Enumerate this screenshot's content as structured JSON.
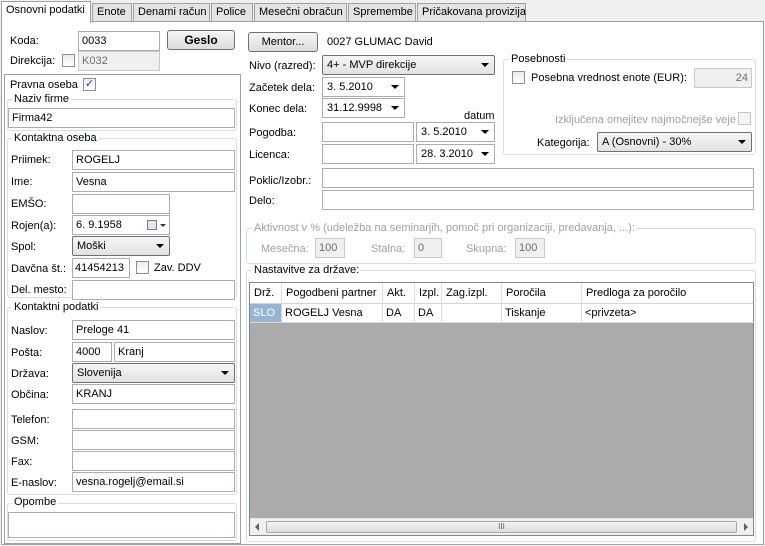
{
  "tabs": [
    "Osnovni podatki",
    "Enote",
    "Denami račun",
    "Police",
    "Mesečni obračun",
    "Spremembe",
    "Pričakovana provizija"
  ],
  "header": {
    "koda_label": "Koda:",
    "koda_value": "0033",
    "geslo_button": "Geslo",
    "direkcija_label": "Direkcija:",
    "direkcija_value": "K032",
    "mentor_button": "Mentor...",
    "mentor_value": "0027 GLUMAC David"
  },
  "left": {
    "pravna_oseba_label": "Pravna oseba",
    "pravna_oseba_checked": "✓",
    "naziv_firme_title": "Naziv firme",
    "naziv_firme_value": "Firma42",
    "kontaktna_oseba_title": "Kontaktna oseba",
    "priimek_label": "Priimek:",
    "priimek_value": "ROGELJ",
    "ime_label": "Ime:",
    "ime_value": "Vesna",
    "emso_label": "EMŠO:",
    "emso_value": "",
    "rojen_label": "Rojen(a):",
    "rojen_value": "6. 9.1958",
    "spol_label": "Spol:",
    "spol_value": "Moški",
    "davcna_label": "Davčna št.:",
    "davcna_value": "41454213",
    "zav_ddv_label": "Zav. DDV",
    "del_mesto_label": "Del. mesto:",
    "del_mesto_value": "",
    "kontaktni_podatki_title": "Kontaktni podatki",
    "naslov_label": "Naslov:",
    "naslov_value": "Preloge 41",
    "posta_label": "Pošta:",
    "posta_code": "4000",
    "posta_city": "Kranj",
    "drzava_label": "Država:",
    "drzava_value": "Slovenija",
    "obcina_label": "Občina:",
    "obcina_value": "KRANJ",
    "telefon_label": "Telefon:",
    "telefon_value": "",
    "gsm_label": "GSM:",
    "gsm_value": "",
    "fax_label": "Fax:",
    "fax_value": "",
    "enaslov_label": "E-naslov:",
    "enaslov_value": "vesna.rogelj@email.si",
    "opombe_title": "Opombe",
    "opombe_value": ""
  },
  "right": {
    "nivo_label": "Nivo (razred):",
    "nivo_value": "4+ - MVP direkcije",
    "zacetek_label": "Začetek dela:",
    "zacetek_value": "3. 5.2010",
    "konec_label": "Konec dela:",
    "konec_value": "31.12.9998",
    "datum_label": "datum",
    "pogodba_label": "Pogodba:",
    "pogodba_value": "",
    "pogodba_date": "3. 5.2010",
    "licenca_label": "Licenca:",
    "licenca_value": "",
    "licenca_date": "28. 3.2010",
    "poklic_label": "Poklic/Izobr.:",
    "poklic_value": "",
    "delo_label": "Delo:",
    "delo_value": "",
    "posebnosti_title": "Posebnosti",
    "posebna_label": "Posebna vrednost enote (EUR):",
    "posebna_value": "24",
    "izkljucena_label": "Izključena omejitev najmočnejše veje",
    "kategorija_label": "Kategorija:",
    "kategorija_value": "A (Osnovni) - 30%",
    "aktivnost_title": "Aktivnost v % (udeležba na seminarjih, pomoč pri organizaciji, predavanja, ...):",
    "mesecna_label": "Mesečna:",
    "mesecna_value": "100",
    "stalna_label": "Stalna:",
    "stalna_value": "0",
    "skupna_label": "Skupna:",
    "skupna_value": "100",
    "nastavitve_title": "Nastavitve za države:"
  },
  "grid": {
    "columns": [
      "Drž.",
      "Pogodbeni partner",
      "Akt.",
      "Izpl.",
      "Zag.izpl.",
      "Poročila",
      "Predloga za poročilo"
    ],
    "rows": [
      [
        "SLO",
        "ROGELJ Vesna",
        "DA",
        "DA",
        "",
        "Tiskanje",
        "<privzeta>"
      ]
    ],
    "scroll_grip": "III"
  }
}
